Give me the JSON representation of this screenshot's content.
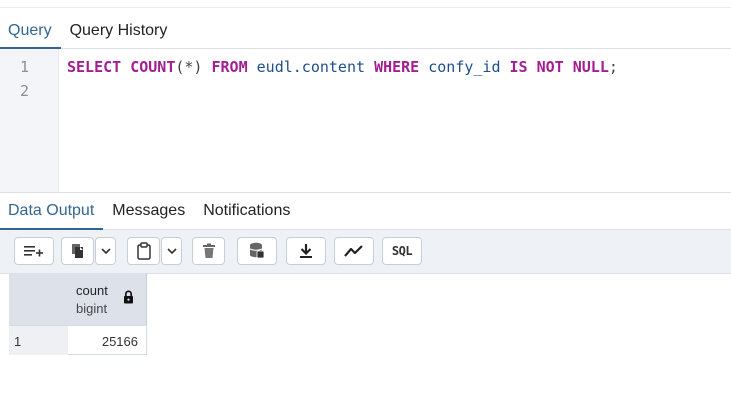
{
  "query_tabs": [
    {
      "label": "Query",
      "active": true
    },
    {
      "label": "Query History",
      "active": false
    }
  ],
  "editor": {
    "line_numbers": [
      "1",
      "2"
    ],
    "line1": {
      "kw_select": "SELECT",
      "fn_count": "COUNT",
      "paren_star": "(*)",
      "kw_from": "FROM",
      "table": "eudl.content",
      "kw_where": "WHERE",
      "column": "confy_id",
      "kw_is": "IS",
      "kw_not": "NOT",
      "kw_null": "NULL",
      "semicolon": ";"
    }
  },
  "output_tabs": [
    {
      "label": "Data Output",
      "active": true
    },
    {
      "label": "Messages",
      "active": false
    },
    {
      "label": "Notifications",
      "active": false
    }
  ],
  "toolbar": {
    "add_row_icon": "add-row-icon",
    "copy_icon": "copy-icon",
    "paste_icon": "paste-icon",
    "delete_icon": "delete-icon",
    "save_data_icon": "save-data-icon",
    "download_icon": "download-icon",
    "graph_icon": "graph-icon",
    "sql_label": "SQL"
  },
  "grid": {
    "columns": [
      {
        "name": "count",
        "type": "bigint",
        "locked": true
      }
    ],
    "rows": [
      {
        "row_number": "1",
        "values": [
          "25166"
        ]
      }
    ]
  },
  "colors": {
    "accent": "#326690",
    "keyword": "#a31e91",
    "identifier": "#1f4f8a"
  }
}
